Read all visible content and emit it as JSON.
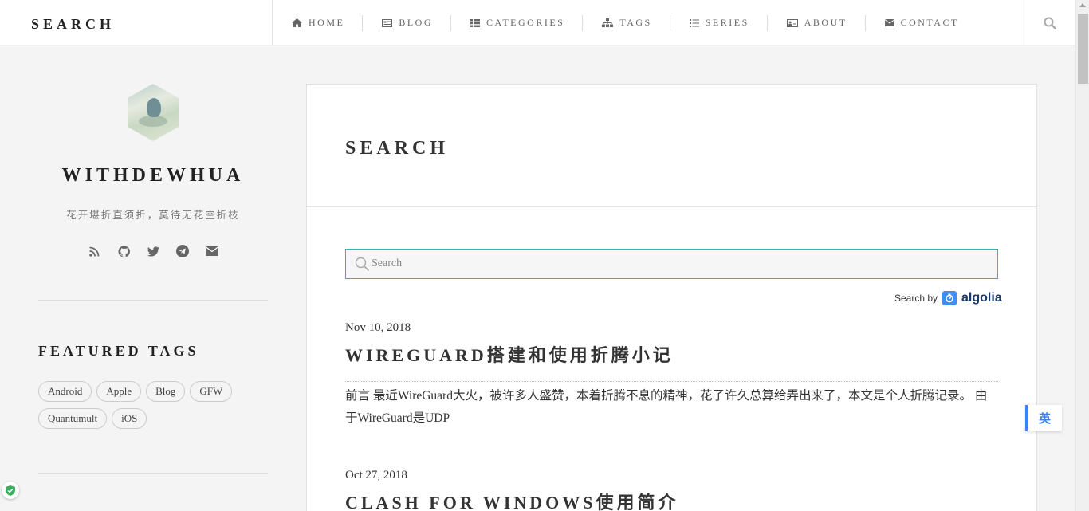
{
  "header": {
    "brand": "SEARCH",
    "nav": [
      {
        "label": "HOME",
        "icon": "home-icon"
      },
      {
        "label": "BLOG",
        "icon": "blog-icon"
      },
      {
        "label": "CATEGORIES",
        "icon": "categories-icon"
      },
      {
        "label": "TAGS",
        "icon": "tags-icon"
      },
      {
        "label": "SERIES",
        "icon": "series-icon"
      },
      {
        "label": "ABOUT",
        "icon": "about-icon"
      },
      {
        "label": "CONTACT",
        "icon": "envelope-icon"
      }
    ],
    "search_icon": "search-icon"
  },
  "sidebar": {
    "site_name": "WITHDEWHUA",
    "motto": "花开堪折直须折，莫待无花空折枝",
    "socials": [
      "rss-icon",
      "github-icon",
      "twitter-icon",
      "telegram-icon",
      "email-icon"
    ],
    "featured_tags_title": "FEATURED TAGS",
    "tags": [
      "Android",
      "Apple",
      "Blog",
      "GFW",
      "Quantumult",
      "iOS"
    ]
  },
  "main": {
    "title": "SEARCH",
    "search_placeholder": "Search",
    "search_by": "Search by",
    "algolia": "algolia",
    "posts": [
      {
        "date": "Nov 10, 2018",
        "title": "WIREGUARD搭建和使用折腾小记",
        "excerpt": "前言 最近WireGuard大火，被许多人盛赞，本着折腾不息的精神，花了许久总算给弄出来了，本文是个人折腾记录。 由于WireGuard是UDP"
      },
      {
        "date": "Oct 27, 2018",
        "title": "CLASH FOR WINDOWS使用简介"
      }
    ]
  },
  "widgets": {
    "lang_badge": "英"
  },
  "colors": {
    "accent": "#33b3b3",
    "algolia_blue": "#3f8ef7",
    "badge_blue": "#3b82f6"
  }
}
